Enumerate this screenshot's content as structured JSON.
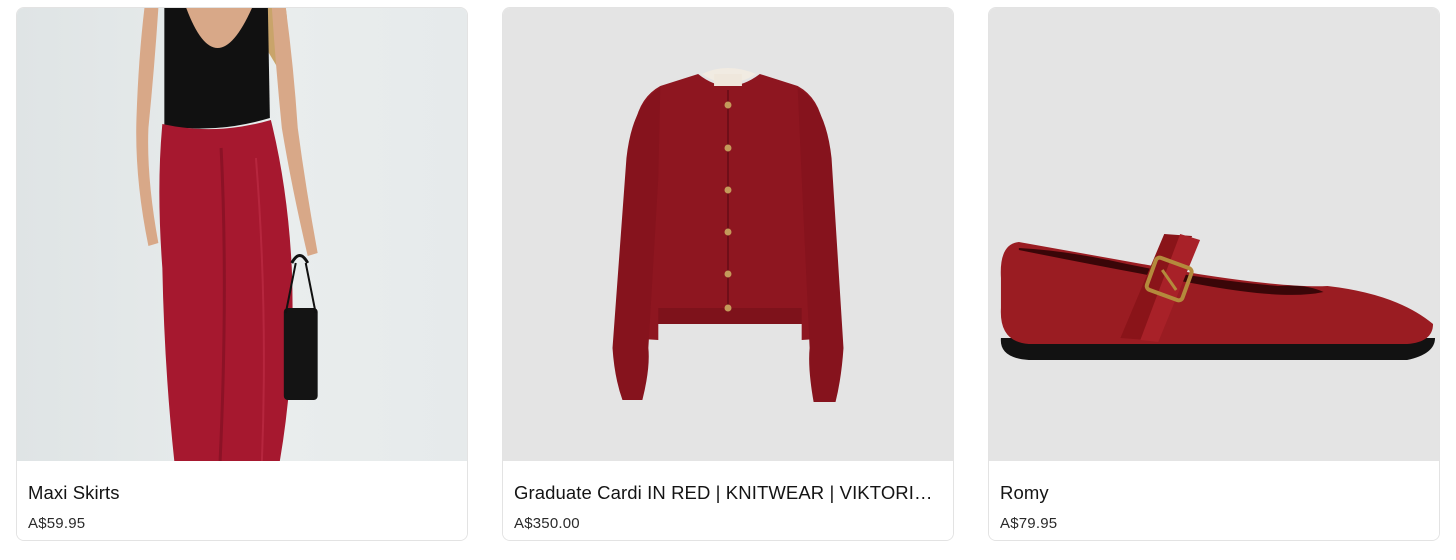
{
  "products": [
    {
      "title": "Maxi Skirts",
      "price": "A$59.95",
      "image_desc": "model wearing red satin maxi skirt with black top and handbag",
      "accent": "#a6182f"
    },
    {
      "title": "Graduate Cardi IN RED | KNITWEAR | VIKTORIA & WOODS",
      "price": "A$350.00",
      "image_desc": "red knit cardigan with gold buttons",
      "accent": "#8e1620"
    },
    {
      "title": "Romy",
      "price": "A$79.95",
      "image_desc": "red leather mary jane flat with gold buckle",
      "accent": "#9a1c22"
    }
  ]
}
